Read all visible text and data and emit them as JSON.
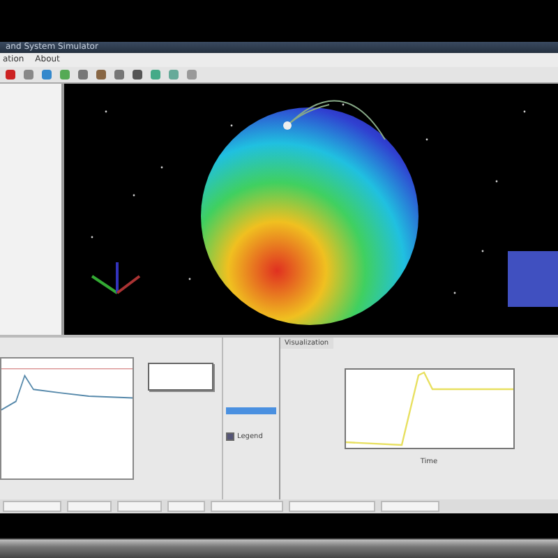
{
  "window": {
    "title": "and System Simulator"
  },
  "menu": [
    {
      "label": "ation"
    },
    {
      "label": "About"
    }
  ],
  "bottom_panel": {
    "title": "Visualization",
    "legend": {
      "label": "Legend",
      "checked": true
    },
    "right_chart": {
      "xlabel": "Time"
    }
  }
}
